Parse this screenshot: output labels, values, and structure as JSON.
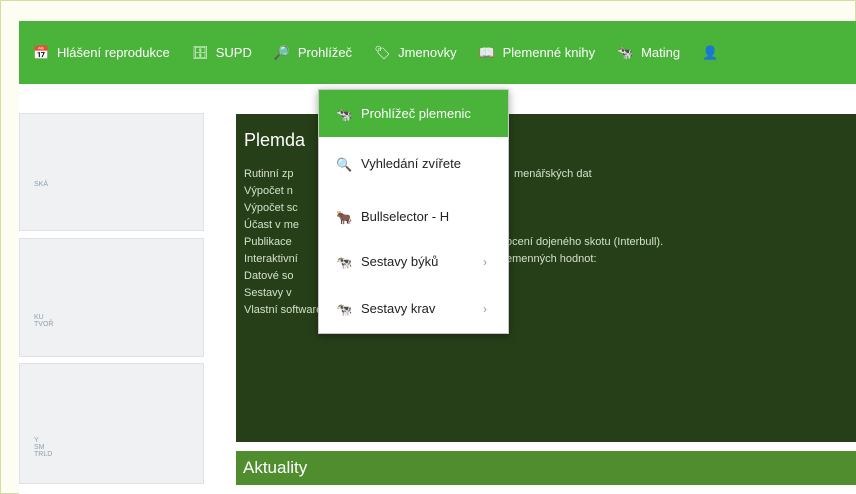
{
  "topbar": {
    "items": [
      {
        "label": "Hlášení reprodukce",
        "icon": "calendar-icon"
      },
      {
        "label": "SUPD",
        "icon": "database-icon"
      },
      {
        "label": "Prohlížeč",
        "icon": "search-document-icon"
      },
      {
        "label": "Jmenovky",
        "icon": "tag-icon"
      },
      {
        "label": "Plemenné knihy",
        "icon": "book-icon"
      },
      {
        "label": "Mating",
        "icon": "cow-icon"
      },
      {
        "label": "",
        "icon": "user-icon"
      }
    ]
  },
  "thumbs": [
    "SKÁ",
    "KU\nTVOŘ",
    "Y\nSM\nTRLD"
  ],
  "hero": {
    "title": "Plemda",
    "lines": [
      "Rutinní zp",
      "Výpočet n",
      "Výpočet sc",
      "Účast v me",
      "Publikace",
      "Interaktivní",
      "Datové so",
      "Sestavy v",
      "Vlastní software."
    ],
    "right_lines": [
      "menářských dat",
      "ocení dojeného skotu (Interbull).",
      "emenných hodnot:"
    ]
  },
  "news": "Aktuality",
  "menu": [
    {
      "label": "Prohlížeč plemenic",
      "icon": "cow-icon",
      "submenu": false
    },
    {
      "label": "Vyhledání zvířete",
      "icon": "search-cow-icon",
      "submenu": false
    },
    {
      "label": "Bullselector - H",
      "icon": "bull-icon",
      "submenu": false
    },
    {
      "label": "Sestavy býků",
      "icon": "cow-icon",
      "submenu": true
    },
    {
      "label": "Sestavy krav",
      "icon": "cow-icon",
      "submenu": true
    }
  ],
  "colors": {
    "green": "#4ab33a",
    "dark": "#263f19",
    "news": "#4f8d2e"
  }
}
